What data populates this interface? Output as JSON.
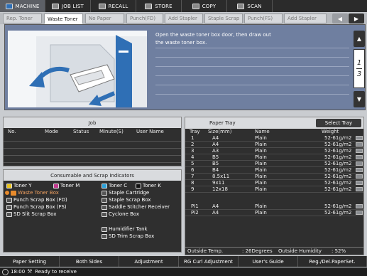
{
  "top_tabs": {
    "machine": "MACHINE",
    "job_list": "JOB LIST",
    "recall": "RECALL",
    "store": "STORE",
    "copy": "COPY",
    "scan": "SCAN"
  },
  "indicator_tabs": [
    {
      "label": "Rep. Toner"
    },
    {
      "label": "Waste Toner"
    },
    {
      "label": "No Paper"
    },
    {
      "label": "Punch(FD)"
    },
    {
      "label": "Add Stapler"
    },
    {
      "label": "Staple Scrap"
    },
    {
      "label": "Punch(FS)"
    },
    {
      "label": "Add Stapler"
    }
  ],
  "message": {
    "line1": "Open the waste toner box door, then draw out",
    "line2": "the waste toner box."
  },
  "pager": {
    "current": "1",
    "total": "3"
  },
  "job_panel": {
    "title": "Job",
    "columns": [
      "No.",
      "Mode",
      "Status",
      "Minute(S)",
      "User Name"
    ]
  },
  "consumable_panel": {
    "title": "Consumable and Scrap Indicators",
    "items": {
      "toner_y": "Toner Y",
      "toner_m": "Toner M",
      "toner_c": "Toner C",
      "toner_k": "Toner K",
      "waste_toner_box": "Waste Toner Box",
      "staple_cartridge": "Staple Cartridge",
      "punch_scrap_fd": "Punch Scrap Box (FD)",
      "staple_scrap_box": "Staple Scrap Box",
      "punch_scrap_fs": "Punch Scrap Box (FS)",
      "saddle_stitcher": "Saddle Stitcher Receiver",
      "sd_slit": "SD Slit Scrap Box",
      "cyclone_box": "Cyclone Box",
      "humidifier_tank": "Humidifier Tank",
      "sd_trim": "SD Trim Scrap Box"
    }
  },
  "paper_tray": {
    "title": "Paper Tray",
    "select_button": "Select Tray",
    "columns": {
      "tray": "Tray",
      "size": "Size(mm)",
      "name": "Name",
      "weight": "Weight"
    },
    "rows": [
      {
        "tray": "1",
        "size": "A4",
        "name": "Plain",
        "weight": "52-61g/m2"
      },
      {
        "tray": "2",
        "size": "A4",
        "name": "Plain",
        "weight": "52-61g/m2"
      },
      {
        "tray": "3",
        "size": "A3",
        "name": "Plain",
        "weight": "52-61g/m2"
      },
      {
        "tray": "4",
        "size": "B5",
        "name": "Plain",
        "weight": "52-61g/m2"
      },
      {
        "tray": "5",
        "size": "B5",
        "name": "Plain",
        "weight": "52-61g/m2"
      },
      {
        "tray": "6",
        "size": "B4",
        "name": "Plain",
        "weight": "52-61g/m2"
      },
      {
        "tray": "7",
        "size": "8.5x11",
        "name": "Plain",
        "weight": "52-61g/m2"
      },
      {
        "tray": "8",
        "size": "9x11",
        "name": "Plain",
        "weight": "52-61g/m2"
      },
      {
        "tray": "9",
        "size": "12x18",
        "name": "Plain",
        "weight": "52-61g/m2"
      }
    ],
    "pi_rows": [
      {
        "tray": "PI1",
        "size": "A4",
        "name": "Plain",
        "weight": "52-61g/m2"
      },
      {
        "tray": "PI2",
        "size": "A4",
        "name": "Plain",
        "weight": "52-61g/m2"
      }
    ],
    "outside_temp_label": "Outside Temp.",
    "outside_temp_value": ": 26Degrees",
    "outside_humidity_label": "Outside Humidity",
    "outside_humidity_value": ": 52%"
  },
  "bottom_buttons": {
    "paper_setting": "Paper Setting",
    "both_sides": "Both Sides",
    "adjustment": "Adjustment",
    "rg_curl": "RG Curl Adjustment",
    "users_guide": "User's Guide",
    "reg_del": "Reg./Del.PaperSet."
  },
  "status": {
    "time": "18:00",
    "message": "Ready to receive"
  },
  "colors": {
    "accent_orange": "#e88b2c",
    "message_panel": "#6f7fa0",
    "illustration_blue": "#2f6fb5"
  }
}
